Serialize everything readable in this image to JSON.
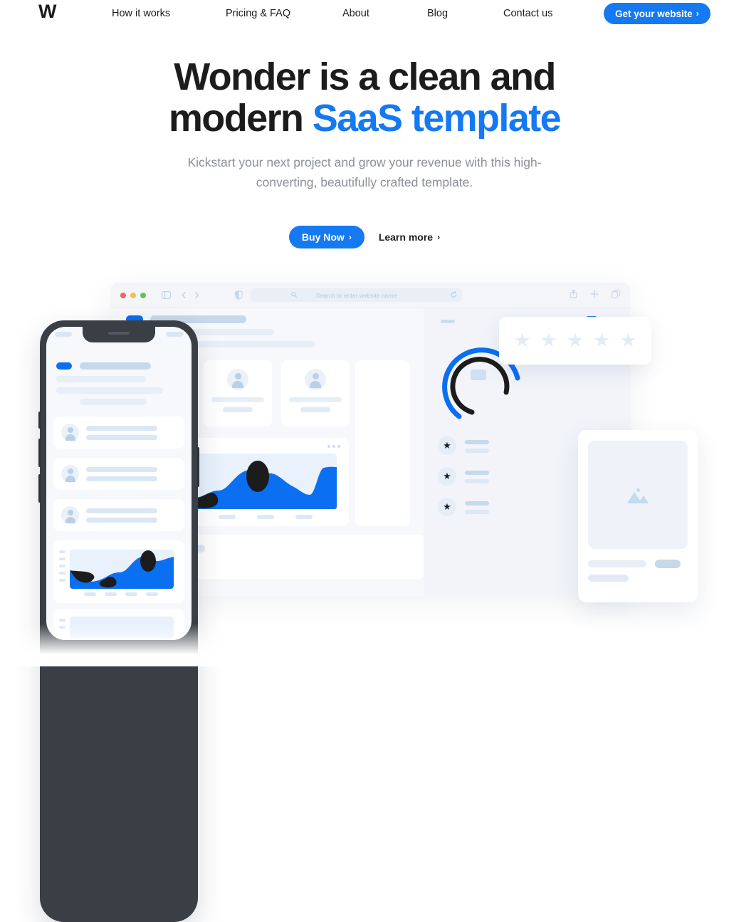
{
  "brand": {
    "logo": "W"
  },
  "nav": {
    "items": [
      {
        "label": "How it works"
      },
      {
        "label": "Pricing & FAQ"
      },
      {
        "label": "About"
      },
      {
        "label": "Blog"
      },
      {
        "label": "Contact us"
      }
    ],
    "cta": {
      "label": "Get your website",
      "chevron": "›",
      "color": "#1579f2"
    }
  },
  "hero": {
    "heading_part1": "Wonder is a clean and",
    "heading_part2": "modern ",
    "heading_accent": "SaaS template",
    "accent_color": "#1579f2",
    "subtitle_line1": "Kickstart your next project and grow your revenue with this high-",
    "subtitle_line2": "converting, beautifully crafted template.",
    "primary_cta": {
      "label": "Buy Now",
      "chevron": "›"
    },
    "secondary_cta": {
      "label": "Learn more",
      "chevron": "›"
    }
  },
  "browser": {
    "traffic_lights": [
      "close-red",
      "minimize-yellow",
      "maximize-green"
    ],
    "icons": {
      "sidebar": "sidebar-icon",
      "back": "‹",
      "forward": "›",
      "shield": "shield-icon",
      "search": "search-icon",
      "reload": "↻",
      "share": "share-icon",
      "new_tab": "+",
      "tabs": "tabs-icon"
    },
    "address_placeholder": "Search or enter website name"
  },
  "dashboard": {
    "user_cards_count": 3,
    "list_items_count": 3,
    "stars_count": 5,
    "toggle_on": true,
    "colors": {
      "blue": "#1579f2",
      "chart_blue": "#0a6ff0",
      "chart_dark": "#1c1c1c",
      "plot_bg": "#e8f1fc",
      "skeleton": "#dce7f3",
      "panel_bg": "#f2f4fa",
      "surface": "#f7f8fb"
    }
  },
  "chart_data": {
    "type": "area",
    "title": "",
    "xlabel": "",
    "ylabel": "",
    "grid": false,
    "legend": null,
    "x": [
      0,
      10,
      20,
      30,
      40,
      50,
      60,
      70,
      80,
      90,
      100
    ],
    "series": [
      {
        "name": "primary-blue-area",
        "color": "#0a6ff0",
        "values": [
          42,
          18,
          12,
          14,
          20,
          62,
          70,
          58,
          64,
          22,
          78
        ]
      },
      {
        "name": "dark-overlay-blobs",
        "color": "#1c1c1c",
        "values": [
          40,
          14,
          6,
          10,
          24,
          30,
          84,
          40,
          10,
          4,
          6
        ]
      }
    ],
    "ylim": [
      0,
      100
    ],
    "xtick_labels": [
      "",
      "",
      "",
      ""
    ],
    "ytick_labels": [
      "",
      "",
      "",
      "",
      ""
    ]
  }
}
